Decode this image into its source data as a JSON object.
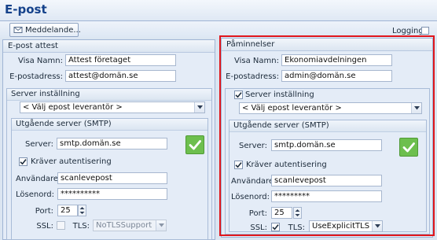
{
  "header": {
    "title": "E-post"
  },
  "toolbar": {
    "message_button": "Meddelande...",
    "logging_label": "Logging",
    "logging_checked": false
  },
  "left": {
    "panel_title": "E-post attest",
    "display_name_label": "Visa Namn:",
    "display_name": "Attest företaget",
    "email_label": "E-postadress:",
    "email": "attest@domän.se",
    "server_settings": {
      "title": "Server inställning",
      "provider": "< Välj epost leverantör >",
      "smtp": {
        "title": "Utgående server (SMTP)",
        "server_label": "Server:",
        "server": "smtp.domän.se",
        "auth_label": "Kräver autentisering",
        "auth_checked": true,
        "user_label": "Användare:",
        "user": "scanlevepost",
        "password_label": "Lösenord:",
        "password": "**********",
        "port_label": "Port:",
        "port": "25",
        "ssl_label": "SSL:",
        "ssl_checked": false,
        "tls_label": "TLS:",
        "tls": "NoTLSSupport"
      }
    }
  },
  "right": {
    "panel_title": "Påminnelser",
    "display_name_label": "Visa Namn:",
    "display_name": "Ekonomiavdelningen",
    "email_label": "E-postadress:",
    "email": "admin@domän.se",
    "server_settings": {
      "title": "Server inställning",
      "title_checked": true,
      "provider": "< Välj epost leverantör >",
      "smtp": {
        "title": "Utgående server (SMTP)",
        "server_label": "Server:",
        "server": "smtp.domän.se",
        "auth_label": "Kräver autentisering",
        "auth_checked": true,
        "user_label": "Användare:",
        "user": "scanlevepost",
        "password_label": "Lösenord:",
        "password": "*********",
        "port_label": "Port:",
        "port": "25",
        "ssl_label": "SSL:",
        "ssl_checked": true,
        "tls_label": "TLS:",
        "tls": "UseExplicitTLS"
      }
    }
  },
  "colors": {
    "highlight": "#e0161c",
    "verify": "#6dbf4e",
    "title": "#15428b"
  },
  "icons": [
    "envelope-icon",
    "checkmark-icon",
    "chevron-down-icon",
    "spinner-arrows-icon"
  ]
}
